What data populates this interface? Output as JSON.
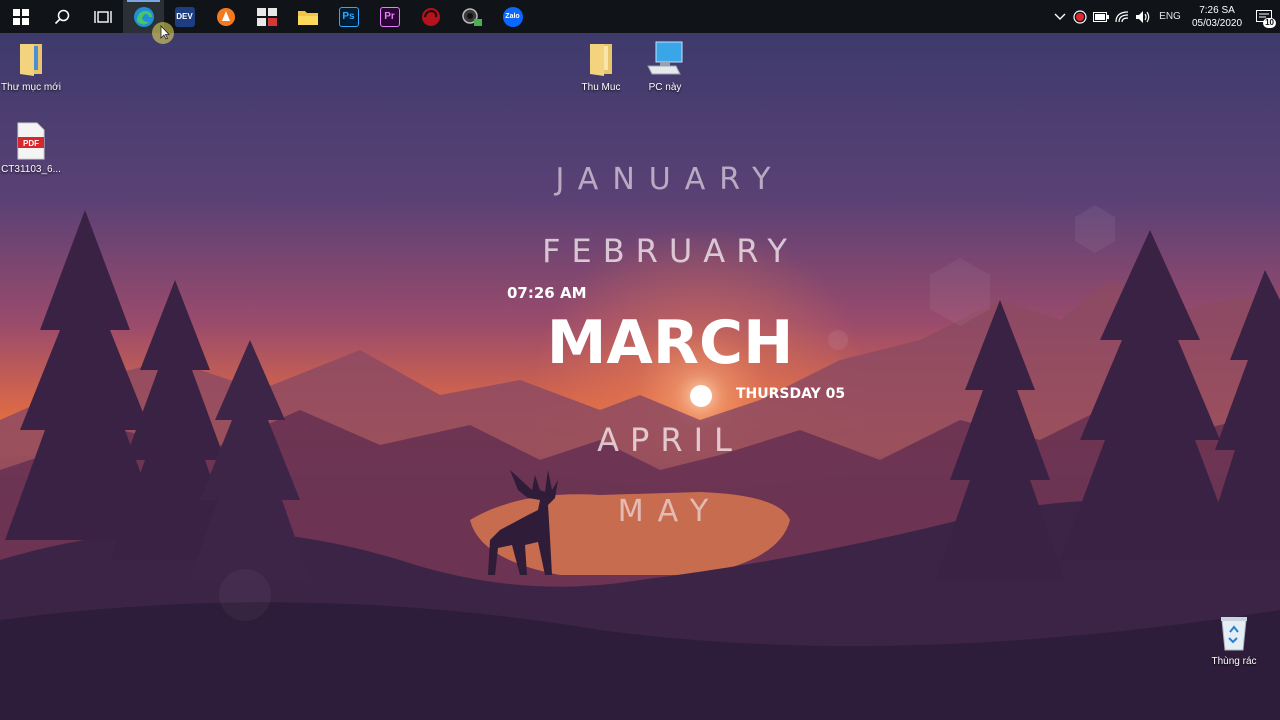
{
  "taskbar": {
    "apps": [
      {
        "name": "windows-start",
        "label": ""
      },
      {
        "name": "search",
        "label": ""
      },
      {
        "name": "task-view",
        "label": ""
      },
      {
        "name": "edge",
        "label": ""
      },
      {
        "name": "dev-cpp",
        "label": "DEV"
      },
      {
        "name": "avast",
        "label": ""
      },
      {
        "name": "app-tiles",
        "label": ""
      },
      {
        "name": "file-explorer",
        "label": ""
      },
      {
        "name": "photoshop",
        "label": "Ps"
      },
      {
        "name": "premiere",
        "label": "Pr"
      },
      {
        "name": "red-app",
        "label": ""
      },
      {
        "name": "webcam-app",
        "label": ""
      },
      {
        "name": "zalo",
        "label": "Zalo"
      }
    ],
    "tray": {
      "language": "ENG",
      "time": "7:26 SA",
      "date": "05/03/2020",
      "notification_count": "10"
    }
  },
  "desktop": {
    "icons": [
      {
        "label": "Thư mục mới"
      },
      {
        "label": "CT31103_6..."
      },
      {
        "label": "Thu Muc"
      },
      {
        "label": "PC này"
      },
      {
        "label": "Thùng rác"
      }
    ],
    "pdf_badge": "PDF"
  },
  "widget": {
    "months": [
      "JANUARY",
      "FEBRUARY",
      "MARCH",
      "APRIL",
      "MAY"
    ],
    "time": "07:26 AM",
    "day": "THURSDAY 05"
  },
  "colors": {
    "sky_top": "#3a3d6e",
    "sky_mid": "#8a4a6e",
    "horizon": "#e2703e",
    "taskbar": "#101318",
    "mountains": "#5a2f4e",
    "trees": "#3a2244"
  }
}
